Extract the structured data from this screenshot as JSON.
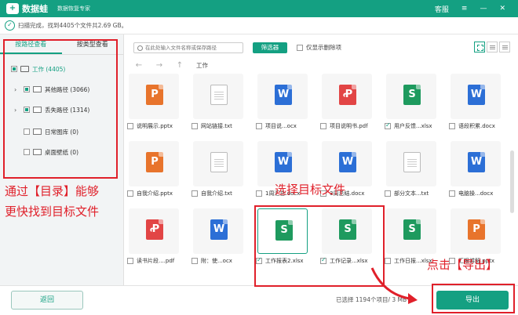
{
  "titlebar": {
    "logo_glyph": "+",
    "app_name": "数据蛙",
    "slogan": "数据恢复专家",
    "support": "客服",
    "controls": [
      "≡",
      "—",
      "✕"
    ]
  },
  "status": {
    "message": "扫描完成，找到4405个文件共2.69 GB。"
  },
  "sidebar": {
    "tabs": [
      "按路径查看",
      "按类型查看"
    ],
    "tree": [
      {
        "label": "工作 (4405)"
      },
      {
        "label": "其他路径 (3066)"
      },
      {
        "label": "丢失路径 (1314)"
      },
      {
        "label": "日常图库 (0)"
      },
      {
        "label": "桌面壁纸 (0)"
      }
    ]
  },
  "toolbar": {
    "search_placeholder": "在此处输入文件名称或保存路径",
    "filter": "筛选器",
    "only_deleted": "仅显示删除项"
  },
  "nav": {
    "back": "←",
    "forward": "→",
    "up": "↑",
    "path": "工作"
  },
  "files": [
    {
      "name": "说明展示.pptx",
      "type": "ppt",
      "glyph": "P",
      "checked": false
    },
    {
      "name": "网站链接.txt",
      "type": "txt",
      "glyph": "",
      "checked": false
    },
    {
      "name": "项目说...ocx",
      "type": "word",
      "glyph": "W",
      "checked": false
    },
    {
      "name": "项目说明书.pdf",
      "type": "pdf",
      "glyph": "Ꝓ",
      "checked": false
    },
    {
      "name": "用户反馈...xlsx",
      "type": "excel",
      "glyph": "S",
      "checked": true
    },
    {
      "name": "语段积累.docx",
      "type": "word",
      "glyph": "W",
      "checked": false
    },
    {
      "name": "自我介绍.pptx",
      "type": "ppt",
      "glyph": "P",
      "checked": false
    },
    {
      "name": "自我介绍.txt",
      "type": "txt",
      "glyph": "",
      "checked": false
    },
    {
      "name": "1周汇总.docx",
      "type": "word",
      "glyph": "W",
      "checked": false
    },
    {
      "name": "3周总结.docx",
      "type": "word",
      "glyph": "W",
      "checked": false
    },
    {
      "name": "部分文本...txt",
      "type": "txt",
      "glyph": "",
      "checked": false
    },
    {
      "name": "电脑操...docx",
      "type": "word",
      "glyph": "W",
      "checked": false
    },
    {
      "name": "读书片段....pdf",
      "type": "pdf",
      "glyph": "Ꝓ",
      "checked": false
    },
    {
      "name": "附：使...ocx",
      "type": "word",
      "glyph": "W",
      "checked": false
    },
    {
      "name": "工作报表2.xlsx",
      "type": "excel",
      "glyph": "S",
      "checked": true
    },
    {
      "name": "工作记录...xlsx",
      "type": "excel",
      "glyph": "S",
      "checked": true
    },
    {
      "name": "工作日报...xlsx",
      "type": "excel",
      "glyph": "S",
      "checked": false
    },
    {
      "name": "汇报讲解.pptx",
      "type": "ppt",
      "glyph": "P",
      "checked": false
    }
  ],
  "footer": {
    "back": "返回",
    "summary": "已选择 1194个项目/ 3 MB",
    "export": "导出"
  },
  "annotations": {
    "sidebar_note_1": "通过【目录】能够",
    "sidebar_note_2": "更快找到目标文件",
    "select_note": "选择目标文件",
    "export_note": "点击【导出】"
  },
  "colors": {
    "brand": "#14a082",
    "ppt": "#e8742c",
    "word": "#2c6fd6",
    "pdf": "#e24545",
    "excel": "#1e9a5e",
    "annotation": "#e0202a"
  }
}
